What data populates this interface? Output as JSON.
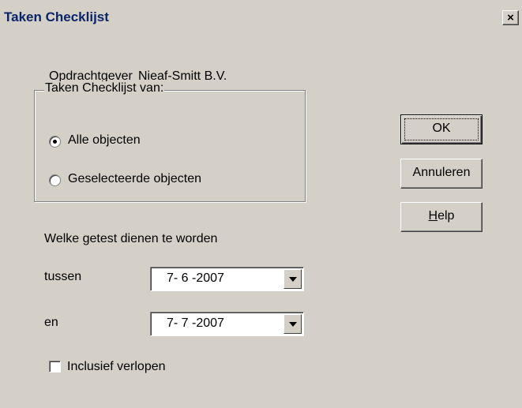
{
  "window": {
    "title": "Taken Checklijst",
    "close_glyph": "×"
  },
  "dialog": {
    "client_label": "Opdrachtgever",
    "client_value": "Nieaf-Smitt B.V.",
    "group_title": "Taken Checklijst van:",
    "radio_options": [
      {
        "label": "Alle objecten",
        "checked": true
      },
      {
        "label": "Geselecteerde objecten",
        "checked": false
      }
    ],
    "date_prompt": "Welke getest dienen te worden",
    "from_label": "tussen",
    "from_value": "7- 6 -2007",
    "to_label": "en",
    "to_value": "7- 7 -2007",
    "include_expired_label": "Inclusief verlopen",
    "include_expired_checked": false
  },
  "buttons": {
    "ok": "OK",
    "cancel": "Annuleren",
    "help_prefix": "H",
    "help_rest": "elp"
  }
}
